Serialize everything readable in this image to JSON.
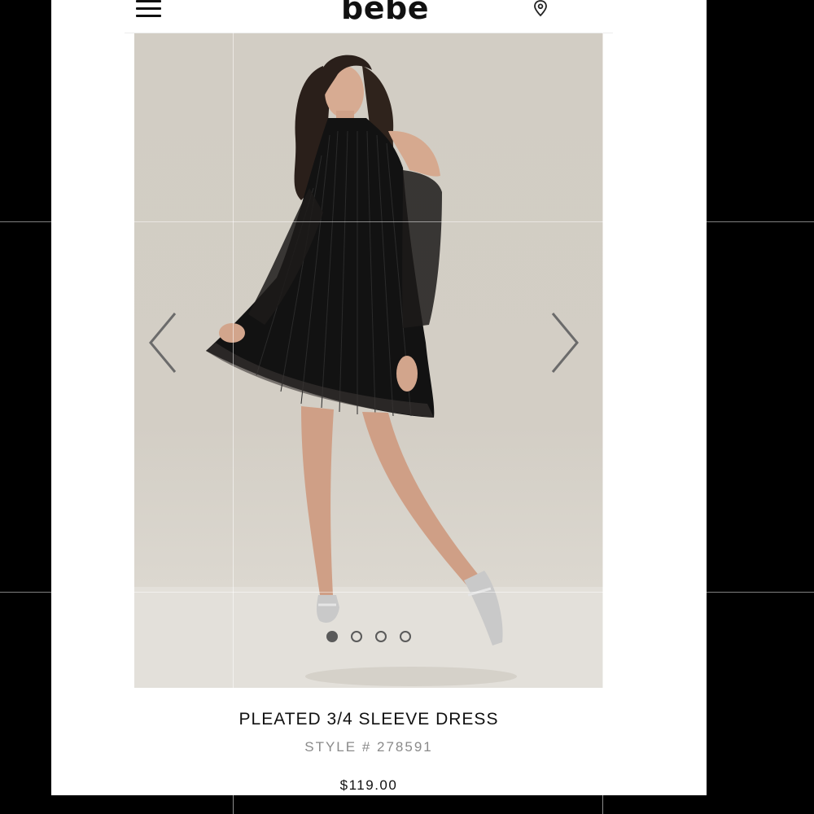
{
  "header": {
    "logo_text": "bebe",
    "menu_icon": "hamburger-menu-icon",
    "location_icon": "map-pin-icon"
  },
  "carousel": {
    "prev_icon": "chevron-left-icon",
    "next_icon": "chevron-right-icon",
    "slide_count": 4,
    "active_index": 0
  },
  "product": {
    "name": "PLEATED 3/4 SLEEVE DRESS",
    "style": "STYLE # 278591",
    "price": "$119.00"
  },
  "colors": {
    "background_outer": "#000000",
    "page": "#ffffff",
    "photo_backdrop": "#d2cdc4",
    "dress": "#111111",
    "text_primary": "#111111",
    "text_muted": "#8a8a8a",
    "dot": "#5a5a5a"
  }
}
